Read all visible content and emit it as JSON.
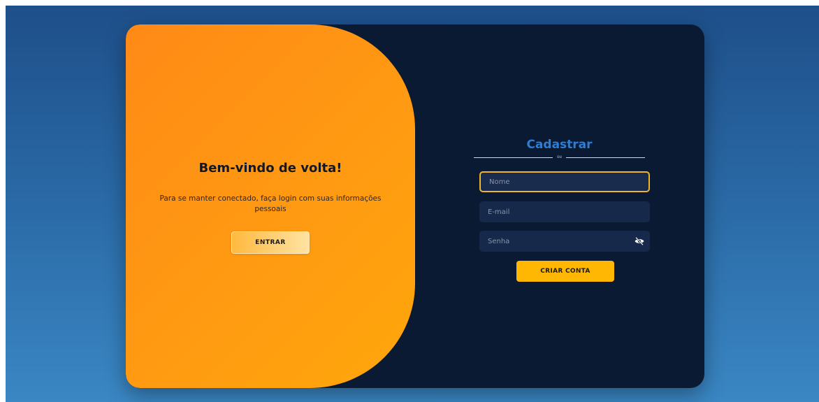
{
  "welcome": {
    "title": "Bem-vindo de volta!",
    "text": "Para se manter conectado, faça login com suas informações pessoais",
    "login_button": "ENTRAR"
  },
  "signup": {
    "title": "Cadastrar",
    "divider_text": "ou",
    "name_placeholder": "Nome",
    "email_placeholder": "E-mail",
    "password_placeholder": "Senha",
    "password_toggle_icon": "eye-slash-icon",
    "submit_button": "CRIAR CONTA"
  },
  "colors": {
    "background_top": "#1e4f8a",
    "background_bottom": "#3a87c4",
    "card": "#0b1a33",
    "panel_orange": "#ff9a12",
    "accent_yellow": "#ffb703",
    "focus_border": "#f1b52c",
    "title_blue": "#2a7ed8",
    "input_bg": "#17294a"
  }
}
